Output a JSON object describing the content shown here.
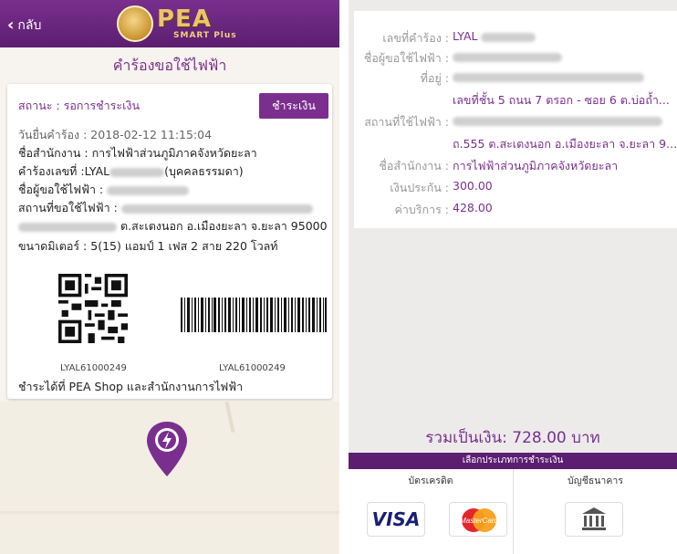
{
  "left": {
    "header": {
      "back_label": "กลับ",
      "logo_text": "PEA",
      "logo_sub": "SMART Plus"
    },
    "title": "คำร้องขอใช้ไฟฟ้า",
    "card": {
      "status": "สถานะ : รอการชำระเงิน",
      "pay_button": "ชำระเงิน",
      "request_date": "วันยื่นคำร้อง : 2018-02-12 11:15:04",
      "office": "ชื่อสำนักงาน : การไฟฟ้าส่วนภูมิภาคจังหวัดยะลา",
      "request_no_label": "คำร้องเลขที่ :LYAL",
      "request_no_suffix": "(บุคคลธรรมดา)",
      "applicant_label": "ชื่อผู้ขอใช้ไฟฟ้า :",
      "location_label": "สถานที่ขอใช้ไฟฟ้า :",
      "location_tail": "ต.สะเตงนอก อ.เมืองยะลา จ.ยะลา 95000",
      "meter": "ขนาดมิเตอร์ : 5(15) แอมป์ 1 เฟส 2 สาย 220 โวลท์",
      "qr_code_text": "LYAL61000249",
      "barcode_text": "LYAL61000249",
      "pay_where": "ชำระได้ที่ PEA Shop และสำนักงานการไฟฟ้า"
    },
    "pin_icon": "lightning-pin-icon"
  },
  "right": {
    "details": [
      {
        "label": "เลขที่คำร้อง :",
        "value": "LYAL"
      },
      {
        "label": "ชื่อผู้ขอใช้ไฟฟ้า :",
        "value": ""
      },
      {
        "label": "ที่อยู่ :",
        "value": ""
      },
      {
        "label": "",
        "value": "เลขที่ชั้น 5 ถนน 7 ตรอก - ซอย 6 ต.บ่อถ้ำ..."
      },
      {
        "label": "สถานที่ใช้ไฟฟ้า :",
        "value": ""
      },
      {
        "label": "",
        "value": "ถ.555 ต.สะเตงนอก อ.เมืองยะลา จ.ยะลา 9..."
      },
      {
        "label": "ชื่อสำนักงาน :",
        "value": "การไฟฟ้าส่วนภูมิภาคจังหวัดยะลา"
      },
      {
        "label": "เงินประกัน :",
        "value": "300.00"
      },
      {
        "label": "ค่าบริการ :",
        "value": "428.00"
      }
    ],
    "total": "รวมเป็นเงิน: 728.00 บาท",
    "payment_header": "เลือกประเภทการชำระเงิน",
    "credit_card_title": "บัตรเครดิต",
    "bank_title": "บัญชีธนาคาร",
    "visa_label": "VISA",
    "mastercard_label": "MasterCard",
    "colors": {
      "primary": "#7a2f8e",
      "header": "#5c1e71",
      "muted": "#999999"
    }
  }
}
